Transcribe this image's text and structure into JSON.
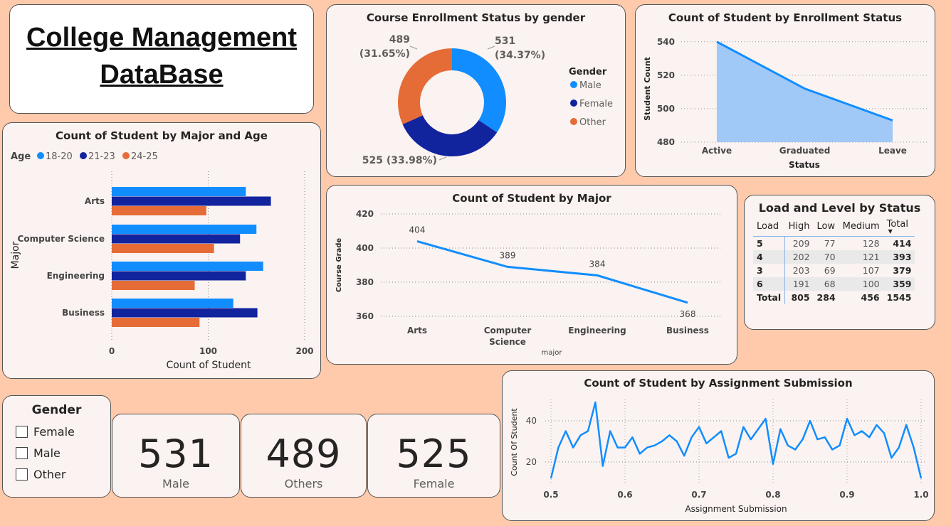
{
  "dashboard": {
    "title": "College Management DataBase"
  },
  "colors": {
    "blue": "#118DFF",
    "navy": "#12239E",
    "orange": "#E66C37",
    "area": "#A0C9F7"
  },
  "enrollment_by_gender": {
    "title": "Course Enrollment Status by gender",
    "legend_title": "Gender",
    "labels": {
      "male": "531\n(34.37%)",
      "female": "525 (33.98%)",
      "other": "489\n(31.65%)"
    },
    "chart_data": {
      "type": "pie",
      "title": "Course Enrollment Status by gender",
      "categories": [
        "Male",
        "Female",
        "Other"
      ],
      "values": [
        531,
        525,
        489
      ],
      "percentages": [
        34.37,
        33.98,
        31.65
      ],
      "colors": [
        "#118DFF",
        "#12239E",
        "#E66C37"
      ]
    }
  },
  "enrollment_status": {
    "title": "Count of Student by Enrollment Status",
    "chart_data": {
      "type": "area",
      "title": "Count of Student by Enrollment Status",
      "categories": [
        "Active",
        "Graduated",
        "Leave"
      ],
      "values": [
        540,
        512,
        493
      ],
      "xlabel": "Status",
      "ylabel": "Student Count",
      "yticks": [
        480,
        500,
        520,
        540
      ],
      "ylim": [
        480,
        545
      ]
    }
  },
  "major_age": {
    "title": "Count of Student by Major and Age",
    "legend_title": "Age",
    "chart_data": {
      "type": "bar",
      "orientation": "horizontal",
      "title": "Count of Student by Major and Age",
      "categories": [
        "Arts",
        "Computer Science",
        "Engineering",
        "Business"
      ],
      "series": [
        {
          "name": "18-20",
          "values": [
            139,
            150,
            157,
            126
          ],
          "color": "#118DFF"
        },
        {
          "name": "21-23",
          "values": [
            165,
            133,
            139,
            151
          ],
          "color": "#12239E"
        },
        {
          "name": "24-25",
          "values": [
            98,
            106,
            86,
            91
          ],
          "color": "#E66C37"
        }
      ],
      "xlabel": "Count of Student",
      "ylabel": "Major",
      "xticks": [
        0,
        100,
        200
      ],
      "xlim": [
        0,
        200
      ]
    }
  },
  "by_major": {
    "title": "Count of Student by Major",
    "chart_data": {
      "type": "line",
      "title": "Count of Student by Major",
      "categories": [
        "Arts",
        "Computer Science",
        "Engineering",
        "Business"
      ],
      "values": [
        404,
        389,
        384,
        368
      ],
      "xlabel": "major",
      "ylabel": "Course Grade",
      "yticks": [
        360,
        380,
        400,
        420
      ],
      "ylim": [
        360,
        420
      ]
    }
  },
  "load_level": {
    "title": "Load and Level by Status",
    "chart_data": {
      "type": "table",
      "columns": [
        "Load",
        "High",
        "Low",
        "Medium",
        "Total"
      ],
      "rows": [
        [
          "5",
          "209",
          "77",
          "128",
          "414"
        ],
        [
          "4",
          "202",
          "70",
          "121",
          "393"
        ],
        [
          "3",
          "203",
          "69",
          "107",
          "379"
        ],
        [
          "6",
          "191",
          "68",
          "100",
          "359"
        ]
      ],
      "total_row": [
        "Total",
        "805",
        "284",
        "456",
        "1545"
      ]
    }
  },
  "assignment": {
    "title": "Count of Student by Assignment Submission",
    "chart_data": {
      "type": "line",
      "title": "Count of Student by Assignment Submission",
      "x": [
        0.5,
        0.51,
        0.52,
        0.53,
        0.54,
        0.55,
        0.56,
        0.57,
        0.58,
        0.59,
        0.6,
        0.61,
        0.62,
        0.63,
        0.64,
        0.65,
        0.66,
        0.67,
        0.68,
        0.69,
        0.7,
        0.71,
        0.72,
        0.73,
        0.74,
        0.75,
        0.76,
        0.77,
        0.78,
        0.79,
        0.8,
        0.81,
        0.82,
        0.83,
        0.84,
        0.85,
        0.86,
        0.87,
        0.88,
        0.89,
        0.9,
        0.91,
        0.92,
        0.93,
        0.94,
        0.95,
        0.96,
        0.97,
        0.98,
        0.99,
        1.0
      ],
      "values": [
        12,
        27,
        35,
        27,
        33,
        35,
        49,
        18,
        35,
        27,
        27,
        32,
        24,
        27,
        28,
        30,
        33,
        30,
        23,
        32,
        37,
        29,
        32,
        35,
        22,
        24,
        37,
        31,
        36,
        41,
        19,
        36,
        28,
        26,
        31,
        40,
        31,
        32,
        26,
        28,
        41,
        33,
        35,
        32,
        38,
        34,
        22,
        27,
        38,
        27,
        12
      ],
      "xlabel": "Assignment Submission",
      "ylabel": "Count Of Student",
      "xticks": [
        "0.5",
        "0.6",
        "0.7",
        "0.8",
        "0.9",
        "1.0"
      ],
      "yticks": [
        20,
        40
      ],
      "xlim": [
        0.5,
        1.0
      ]
    }
  },
  "slicer": {
    "title": "Gender",
    "options": [
      "Female",
      "Male",
      "Other"
    ]
  },
  "kpis": [
    {
      "value": "531",
      "label": "Male"
    },
    {
      "value": "489",
      "label": "Others"
    },
    {
      "value": "525",
      "label": "Female"
    }
  ]
}
